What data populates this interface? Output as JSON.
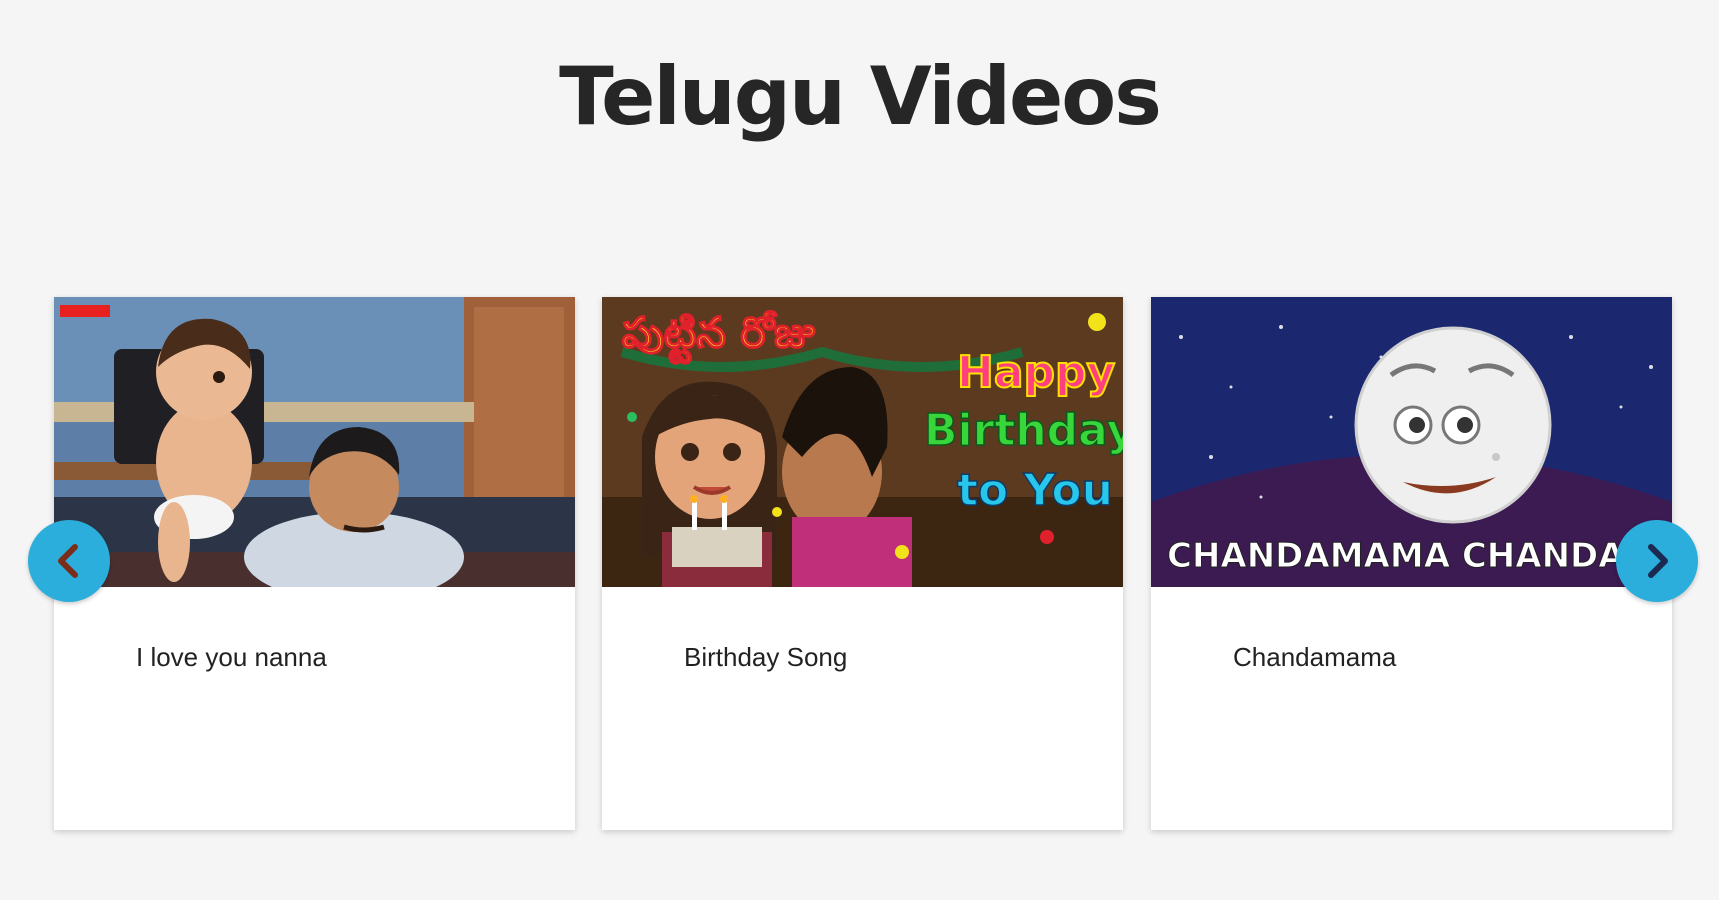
{
  "page": {
    "title": "Telugu Videos"
  },
  "carousel": {
    "prev_icon": "chevron-left-icon",
    "next_icon": "chevron-right-icon",
    "accent_color": "#2baedb",
    "items": [
      {
        "caption": "I love you nanna",
        "thumbnail_icon": "cartoon-baby-and-father-thumbnail"
      },
      {
        "caption": "Birthday Song",
        "thumbnail_icon": "birthday-cartoon-thumbnail",
        "thumbnail_text_telugu": "పుట్టిన రోజు",
        "thumbnail_text_line1": "Happy",
        "thumbnail_text_line2": "Birthday",
        "thumbnail_text_line3": "to You"
      },
      {
        "caption": "Chandamama",
        "thumbnail_icon": "smiling-moon-thumbnail",
        "thumbnail_text": "CHANDAMAMA CHANDAMAMA"
      }
    ]
  }
}
